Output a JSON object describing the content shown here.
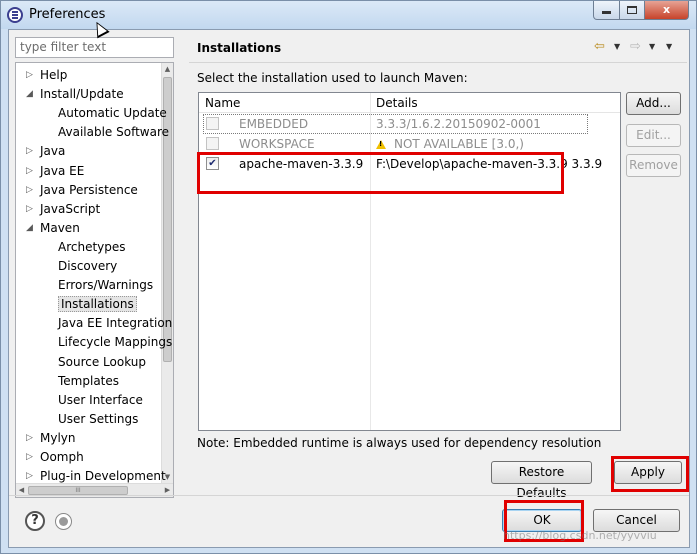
{
  "window": {
    "title": "Preferences",
    "close_glyph": "x",
    "icon": "eclipse-preferences-icon"
  },
  "sidebar": {
    "filter_placeholder": "type filter text",
    "items": [
      {
        "label": "Help",
        "arrow": "▷",
        "level": 0
      },
      {
        "label": "Install/Update",
        "arrow": "◢",
        "level": 0
      },
      {
        "label": "Automatic Update",
        "arrow": "",
        "level": 1
      },
      {
        "label": "Available Software",
        "arrow": "",
        "level": 1
      },
      {
        "label": "Java",
        "arrow": "▷",
        "level": 0
      },
      {
        "label": "Java EE",
        "arrow": "▷",
        "level": 0
      },
      {
        "label": "Java Persistence",
        "arrow": "▷",
        "level": 0
      },
      {
        "label": "JavaScript",
        "arrow": "▷",
        "level": 0
      },
      {
        "label": "Maven",
        "arrow": "◢",
        "level": 0
      },
      {
        "label": "Archetypes",
        "arrow": "",
        "level": 1
      },
      {
        "label": "Discovery",
        "arrow": "",
        "level": 1
      },
      {
        "label": "Errors/Warnings",
        "arrow": "",
        "level": 1
      },
      {
        "label": "Installations",
        "arrow": "",
        "level": 1,
        "selected": true
      },
      {
        "label": "Java EE Integration",
        "arrow": "",
        "level": 1
      },
      {
        "label": "Lifecycle Mappings",
        "arrow": "",
        "level": 1
      },
      {
        "label": "Source Lookup",
        "arrow": "",
        "level": 1
      },
      {
        "label": "Templates",
        "arrow": "",
        "level": 1
      },
      {
        "label": "User Interface",
        "arrow": "",
        "level": 1
      },
      {
        "label": "User Settings",
        "arrow": "",
        "level": 1
      },
      {
        "label": "Mylyn",
        "arrow": "▷",
        "level": 0
      },
      {
        "label": "Oomph",
        "arrow": "▷",
        "level": 0
      },
      {
        "label": "Plug-in Development",
        "arrow": "▷",
        "level": 0
      }
    ]
  },
  "main": {
    "page_title": "Installations",
    "select_label": "Select the installation used to launch Maven:",
    "columns": [
      "Name",
      "Details"
    ],
    "rows": [
      {
        "checked": false,
        "name": "EMBEDDED",
        "details": "3.3.3/1.6.2.20150902-0001",
        "disabled": true,
        "warning": false
      },
      {
        "checked": false,
        "name": "WORKSPACE",
        "details": "NOT AVAILABLE [3.0,)",
        "disabled": true,
        "warning": true
      },
      {
        "checked": true,
        "name": "apache-maven-3.3.9",
        "details": "F:\\Develop\\apache-maven-3.3.9 3.3.9",
        "disabled": false,
        "warning": false
      }
    ],
    "add_label": "Add...",
    "edit_label": "Edit...",
    "remove_label": "Remove",
    "note": "Note: Embedded runtime is always used for dependency resolution",
    "restore_label": "Restore Defaults",
    "apply_label": "Apply"
  },
  "footer": {
    "help_glyph": "?",
    "ok_label": "OK",
    "cancel_label": "Cancel"
  },
  "watermark": "https://blog.csdn.net/yyvviu",
  "colors": {
    "highlight": "#e00000",
    "selection": "#e5e5e5"
  }
}
